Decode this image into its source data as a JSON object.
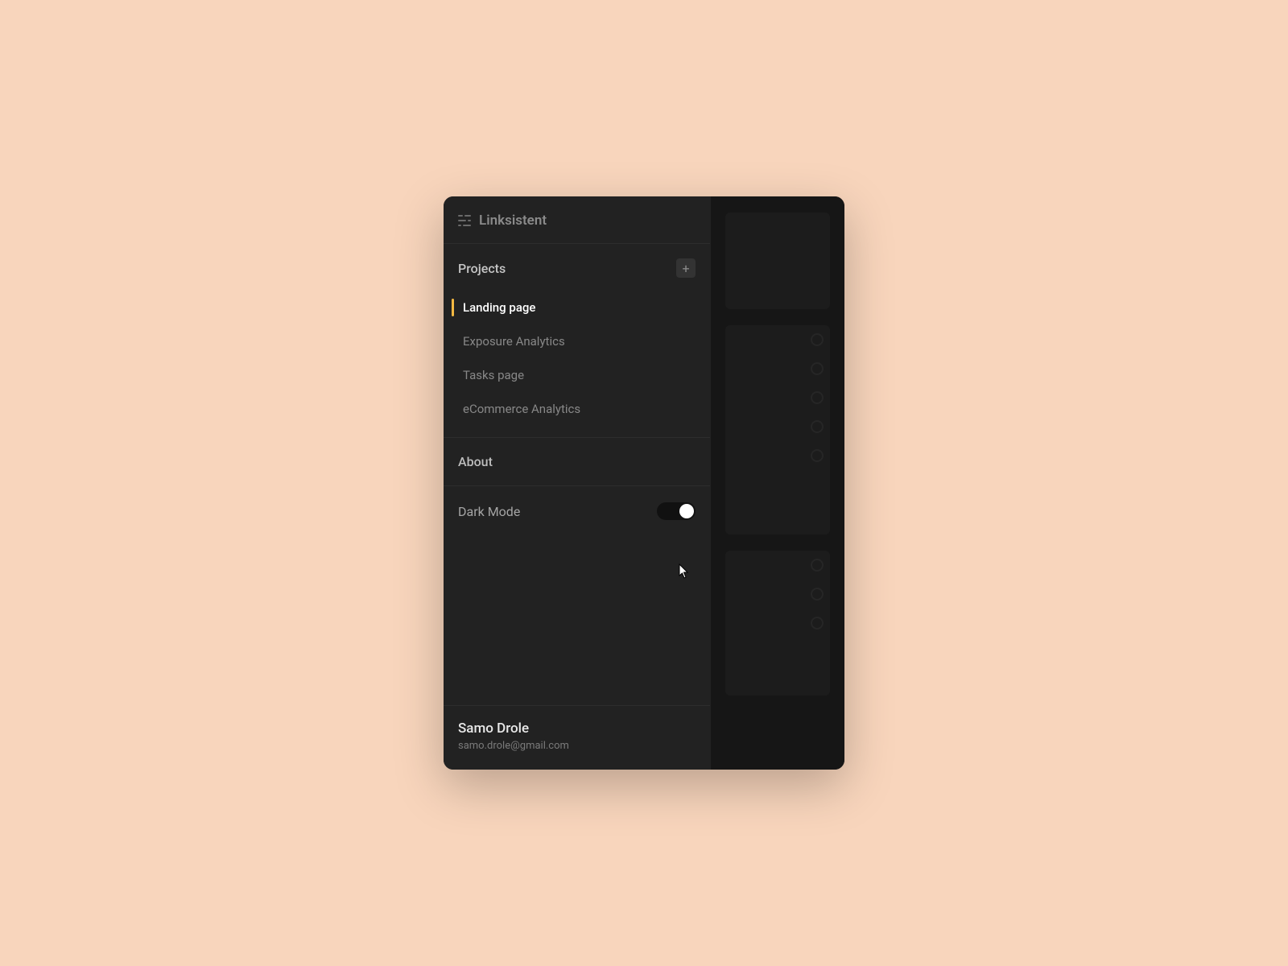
{
  "app": {
    "name": "Linksistent"
  },
  "sidebar": {
    "projects_header": "Projects",
    "projects": [
      {
        "label": "Landing page",
        "active": true
      },
      {
        "label": "Exposure Analytics",
        "active": false
      },
      {
        "label": "Tasks page",
        "active": false
      },
      {
        "label": "eCommerce Analytics",
        "active": false
      }
    ],
    "about_label": "About",
    "dark_mode_label": "Dark Mode",
    "dark_mode_on": true
  },
  "user": {
    "name": "Samo Drole",
    "email": "samo.drole@gmail.com"
  },
  "colors": {
    "accent": "#f5b942",
    "bg_page": "#f8d5bc",
    "bg_window": "#1a1a1a",
    "bg_sidebar": "#222222"
  }
}
